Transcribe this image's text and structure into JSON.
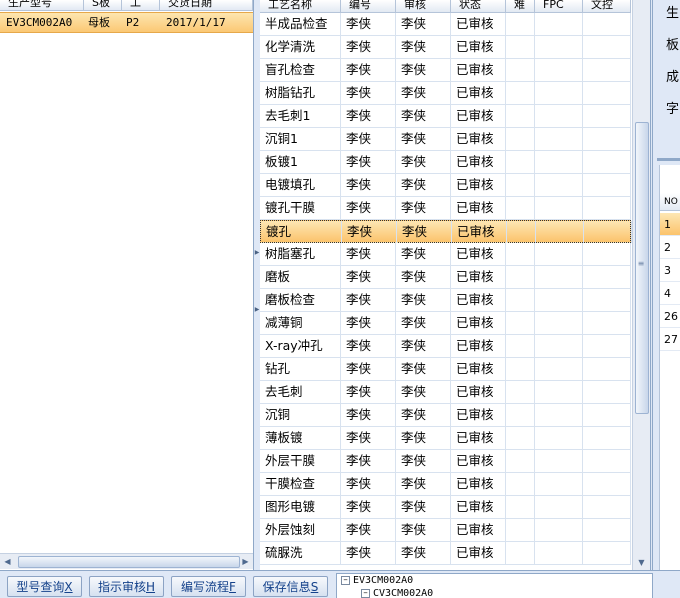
{
  "left_grid": {
    "columns": [
      "生产型号",
      "S板",
      "工",
      "交货日期"
    ],
    "rows": [
      {
        "model": "EV3CM002A0",
        "board": "母板",
        "proc": "P2",
        "date": "2017/1/17"
      }
    ]
  },
  "main_grid": {
    "columns": [
      "工艺名称",
      "编号",
      "审核",
      "状态",
      "难",
      "FPC",
      "文控"
    ],
    "selected_index": 9,
    "rows": [
      {
        "name": "半成品检查",
        "code": "李侠",
        "review": "李侠",
        "status": "已审核"
      },
      {
        "name": "化学清洗",
        "code": "李侠",
        "review": "李侠",
        "status": "已审核"
      },
      {
        "name": "盲孔检查",
        "code": "李侠",
        "review": "李侠",
        "status": "已审核"
      },
      {
        "name": "树脂钻孔",
        "code": "李侠",
        "review": "李侠",
        "status": "已审核"
      },
      {
        "name": "去毛刺1",
        "code": "李侠",
        "review": "李侠",
        "status": "已审核"
      },
      {
        "name": "沉铜1",
        "code": "李侠",
        "review": "李侠",
        "status": "已审核"
      },
      {
        "name": "板镀1",
        "code": "李侠",
        "review": "李侠",
        "status": "已审核"
      },
      {
        "name": "电镀填孔",
        "code": "李侠",
        "review": "李侠",
        "status": "已审核"
      },
      {
        "name": "镀孔干膜",
        "code": "李侠",
        "review": "李侠",
        "status": "已审核"
      },
      {
        "name": "镀孔",
        "code": "李侠",
        "review": "李侠",
        "status": "已审核"
      },
      {
        "name": "树脂塞孔",
        "code": "李侠",
        "review": "李侠",
        "status": "已审核"
      },
      {
        "name": "磨板",
        "code": "李侠",
        "review": "李侠",
        "status": "已审核"
      },
      {
        "name": "磨板检查",
        "code": "李侠",
        "review": "李侠",
        "status": "已审核"
      },
      {
        "name": "减薄铜",
        "code": "李侠",
        "review": "李侠",
        "status": "已审核"
      },
      {
        "name": "X-ray冲孔",
        "code": "李侠",
        "review": "李侠",
        "status": "已审核"
      },
      {
        "name": "钻孔",
        "code": "李侠",
        "review": "李侠",
        "status": "已审核"
      },
      {
        "name": "去毛刺",
        "code": "李侠",
        "review": "李侠",
        "status": "已审核"
      },
      {
        "name": "沉铜",
        "code": "李侠",
        "review": "李侠",
        "status": "已审核"
      },
      {
        "name": "薄板镀",
        "code": "李侠",
        "review": "李侠",
        "status": "已审核"
      },
      {
        "name": "外层干膜",
        "code": "李侠",
        "review": "李侠",
        "status": "已审核"
      },
      {
        "name": "干膜检查",
        "code": "李侠",
        "review": "李侠",
        "status": "已审核"
      },
      {
        "name": "图形电镀",
        "code": "李侠",
        "review": "李侠",
        "status": "已审核"
      },
      {
        "name": "外层蚀刻",
        "code": "李侠",
        "review": "李侠",
        "status": "已审核"
      },
      {
        "name": "硫脲洗",
        "code": "李侠",
        "review": "李侠",
        "status": "已审核"
      }
    ]
  },
  "right_panel": {
    "field_labels": [
      "生",
      "板",
      "成",
      "字"
    ],
    "grid_header": "NO",
    "row_numbers": [
      "1",
      "2",
      "3",
      "4",
      "26",
      "27"
    ]
  },
  "toolbar": {
    "buttons": [
      {
        "label": "型号查询",
        "key": "X"
      },
      {
        "label": "指示审核",
        "key": "H"
      },
      {
        "label": "编写流程",
        "key": "F"
      },
      {
        "label": "保存信息",
        "key": "S"
      }
    ]
  },
  "tree": {
    "root": "EV3CM002A0",
    "child": "CV3CM002A0"
  },
  "colors": {
    "selection": "#fbc874",
    "panel_bg": "#dfe8f6",
    "border": "#8fa8c8",
    "button_text": "#15428b"
  }
}
